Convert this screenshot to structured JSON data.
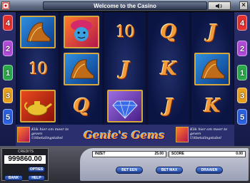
{
  "window": {
    "title": "Welcome to the Casino"
  },
  "paylines": {
    "left": [
      "4",
      "2",
      "1",
      "3",
      "5"
    ],
    "right": [
      "4",
      "2",
      "1",
      "3",
      "5"
    ],
    "colors": [
      "#e53030",
      "#b04ad8",
      "#2aa84a",
      "#e8a020",
      "#2a60e0"
    ]
  },
  "reels": [
    [
      "slipper",
      "10",
      "lamp"
    ],
    [
      "genie",
      "slipper",
      "Q"
    ],
    [
      "10",
      "J",
      "gem"
    ],
    [
      "Q",
      "K",
      "J"
    ],
    [
      "J",
      "slipper",
      "K"
    ]
  ],
  "game": {
    "logo": "Genie's Gems",
    "info_text": "Klik hier om meer te geven Uitbetalingstabel"
  },
  "console": {
    "credits_label": "CREDITS",
    "credits_value": "999860.00",
    "opties_label": "OPTIES",
    "bank_label": "BANK",
    "help_label": "HELP",
    "inzet_label": "INZET",
    "inzet_value": "25.00",
    "score_label": "SCORE",
    "score_value": "0.00",
    "bet_one_label": "BET EEN",
    "bet_max_label": "BET MAX",
    "spin_label": "DRAAIEN"
  }
}
